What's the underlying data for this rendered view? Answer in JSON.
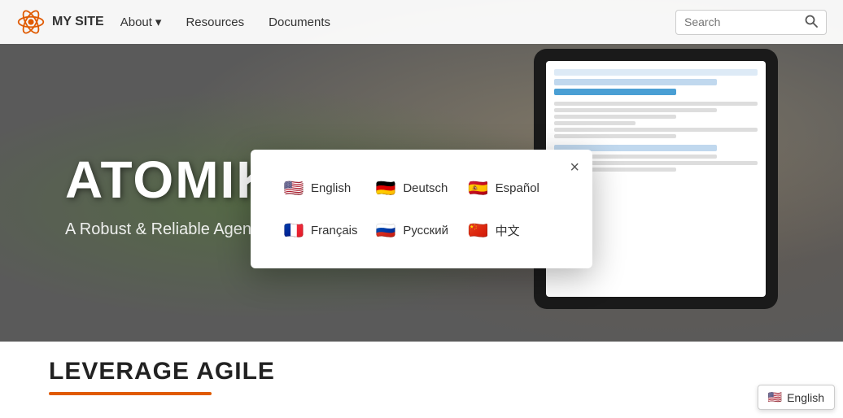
{
  "nav": {
    "logo_text": "MY SITE",
    "links": [
      {
        "label": "About",
        "has_dropdown": true
      },
      {
        "label": "Resources",
        "has_dropdown": false
      },
      {
        "label": "Documents",
        "has_dropdown": false
      }
    ],
    "search_placeholder": "Search",
    "search_button_label": "search"
  },
  "hero": {
    "title": "ATOMIK AGENCY",
    "subtitle": "A Robust & Reliable Agency."
  },
  "modal": {
    "close_label": "×",
    "languages": [
      {
        "code": "en",
        "label": "English",
        "flag_emoji": "🇺🇸"
      },
      {
        "code": "de",
        "label": "Deutsch",
        "flag_emoji": "🇩🇪"
      },
      {
        "code": "es",
        "label": "Español",
        "flag_emoji": "🇪🇸"
      },
      {
        "code": "fr",
        "label": "Français",
        "flag_emoji": "🇫🇷"
      },
      {
        "code": "ru",
        "label": "Русский",
        "flag_emoji": "🇷🇺"
      },
      {
        "code": "zh",
        "label": "中文",
        "flag_emoji": "🇨🇳"
      }
    ]
  },
  "bottom": {
    "title": "LEVERAGE AGILE"
  },
  "footer_lang": {
    "label": "English",
    "flag_emoji": "🇺🇸"
  }
}
